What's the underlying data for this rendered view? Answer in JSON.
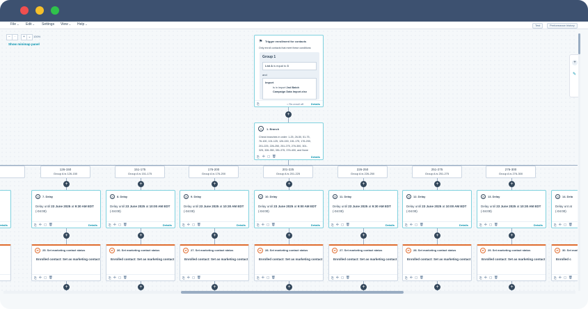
{
  "window": {
    "dot_colors": [
      "#ef4f4f",
      "#f5c02b",
      "#2fc24b"
    ],
    "titlebar_color": "#3d5170"
  },
  "menu": [
    {
      "label": "File",
      "has_chevron": true
    },
    {
      "label": "Edit",
      "has_chevron": true
    },
    {
      "label": "Settings",
      "has_chevron": false
    },
    {
      "label": "View",
      "has_chevron": true
    },
    {
      "label": "Help",
      "has_chevron": true
    }
  ],
  "top_buttons": {
    "test": "Test",
    "performance": "Performance history"
  },
  "zoom": {
    "level": "100%"
  },
  "minimap_label": "Show minimap panel",
  "trigger": {
    "title": "Trigger enrollment for contacts",
    "subtitle": "Only enroll contacts that meet these conditions",
    "group_label": "Group 1",
    "condition1_prefix": "List A",
    "condition1_rest": "is equal to",
    "condition1_value": "3",
    "and_label": "and",
    "import_label": "Import",
    "import_line1": "Is in import",
    "import_value1": "2nd Batch",
    "import_value2": "Campaign Data Import.xlsx",
    "reenroll": "Re-enroll off",
    "details": "Details"
  },
  "branch_node": {
    "title": "1. Branch",
    "text_lines": [
      "Check branches in order: 1-25, 26-50, 51-75,",
      "76-100, 101-125, 126-150, 151-175, 176-200,",
      "201-225, 226-250, 251-275, 276-300, 301-",
      "325, 326-350, 351-375, 376-400, and None"
    ],
    "details": "Details"
  },
  "branches": [
    {
      "range": "",
      "cond": ""
    },
    {
      "range": "126-150",
      "cond": "Group A is 126-150"
    },
    {
      "range": "151-175",
      "cond": "Group A is 151-175"
    },
    {
      "range": "176-200",
      "cond": "Group A is 176-200"
    },
    {
      "range": "201-225",
      "cond": "Group A is 201-225"
    },
    {
      "range": "226-250",
      "cond": "Group A is 226-250"
    },
    {
      "range": "251-275",
      "cond": "Group A is 251-275"
    },
    {
      "range": "276-300",
      "cond": "Group A is 276-300"
    }
  ],
  "delays": [
    {
      "title": "",
      "line1": "M EDT",
      "line2": ""
    },
    {
      "title": "7. Delay",
      "line1_prefix": "Delay until",
      "date": "23 June 2025",
      "time": "9:30 AM EDT",
      "tz": "(-04:00)"
    },
    {
      "title": "8. Delay",
      "line1_prefix": "Delay until",
      "date": "23 June 2025",
      "time": "10:00 AM EDT",
      "tz": "(-04:00)"
    },
    {
      "title": "9. Delay",
      "line1_prefix": "Delay until",
      "date": "23 June 2025",
      "time": "10:30 AM EDT",
      "tz": "(-04:00)"
    },
    {
      "title": "10. Delay",
      "line1_prefix": "Delay until",
      "date": "23 June 2025",
      "time": "9:00 AM EDT",
      "tz": "(-04:00)"
    },
    {
      "title": "11. Delay",
      "line1_prefix": "Delay until",
      "date": "23 June 2025",
      "time": "9:30 AM EDT",
      "tz": "(-04:00)"
    },
    {
      "title": "12. Delay",
      "line1_prefix": "Delay until",
      "date": "23 June 2025",
      "time": "10:00 AM EDT",
      "tz": "(-04:00)"
    },
    {
      "title": "13. Delay",
      "line1_prefix": "Delay until",
      "date": "23 June 2025",
      "time": "10:30 AM EDT",
      "tz": "(-04:00)"
    },
    {
      "title": "14. Dela",
      "line1_prefix": "Delay unt",
      "date": "",
      "time": "",
      "tz": "(-04:00)"
    }
  ],
  "statuses": [
    {
      "title": "",
      "text": "contact"
    },
    {
      "title": "25. Set marketing contact status",
      "text": "Enrolled contact: Set as marketing contact"
    },
    {
      "title": "26. Set marketing contact status",
      "text": "Enrolled contact: Set as marketing contact"
    },
    {
      "title": "27. Set marketing contact status",
      "text": "Enrolled contact: Set as marketing contact"
    },
    {
      "title": "28. Set marketing contact status",
      "text": "Enrolled contact: Set as marketing contact"
    },
    {
      "title": "27. Set marketing contact status",
      "text": "Enrolled contact: Set as marketing contact"
    },
    {
      "title": "28. Set marketing contact status",
      "text": "Enrolled contact: Set as marketing contact"
    },
    {
      "title": "29. Set marketing contact status",
      "text": "Enrolled contact: Set as marketing contact"
    },
    {
      "title": "30. Set marke",
      "text": "Enrolled c"
    }
  ],
  "details_label": "Details"
}
